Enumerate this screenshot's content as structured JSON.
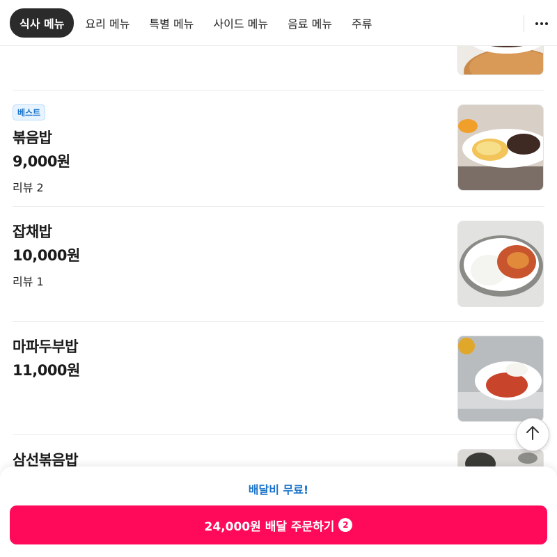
{
  "categories": [
    {
      "label": "식사 메뉴",
      "active": true
    },
    {
      "label": "요리 메뉴",
      "active": false
    },
    {
      "label": "특별 메뉴",
      "active": false
    },
    {
      "label": "사이드 메뉴",
      "active": false
    },
    {
      "label": "음료 메뉴",
      "active": false
    },
    {
      "label": "주류",
      "active": false
    }
  ],
  "more_icon": "more-horizontal-icon",
  "menu_items": [
    {
      "badge": "베스트",
      "name": "볶음밥",
      "price": "9,000원",
      "review": "리뷰 2"
    },
    {
      "name": "잡채밥",
      "price": "10,000원",
      "review": "리뷰 1"
    },
    {
      "name": "마파두부밥",
      "price": "11,000원"
    },
    {
      "name": "삼선볶음밥"
    }
  ],
  "scroll_top_icon": "arrow-up-icon",
  "order_panel": {
    "delivery_note": "배달비 무료!",
    "button_label": "24,000원 배달 주문하기",
    "item_count": "2"
  },
  "colors": {
    "accent": "#ff0a5a",
    "info": "#1a73c9"
  }
}
